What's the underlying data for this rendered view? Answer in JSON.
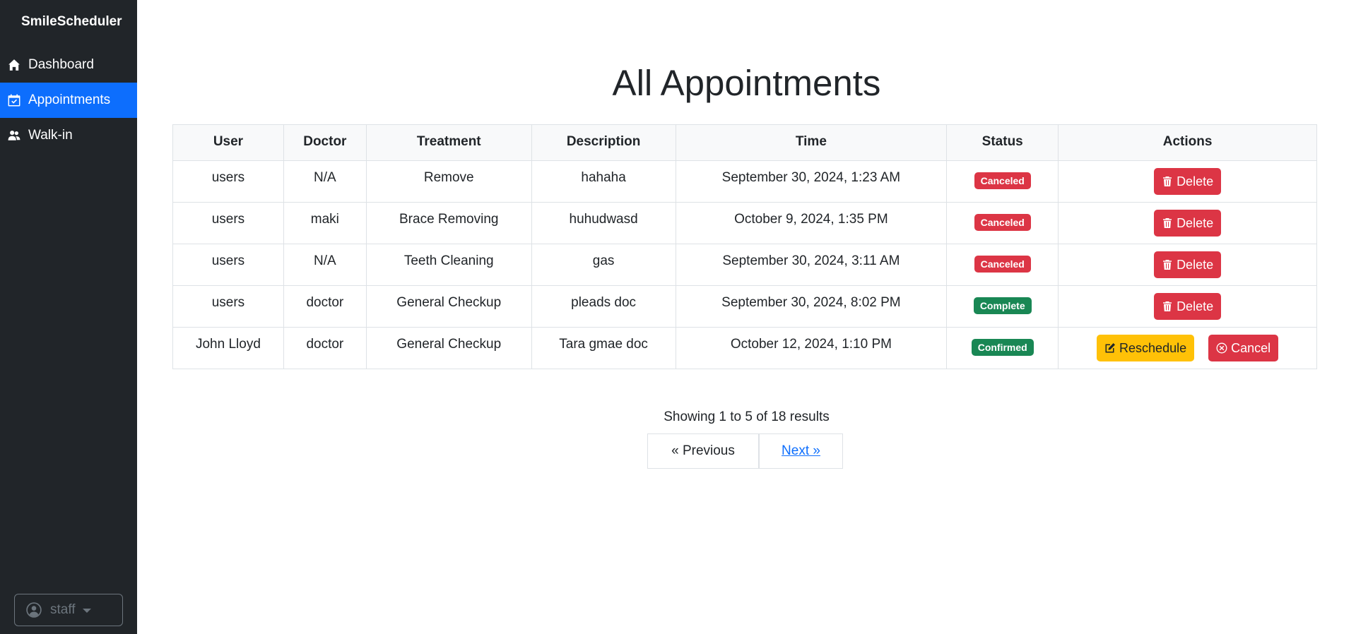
{
  "app": {
    "brand": "SmileScheduler"
  },
  "sidebar": {
    "items": [
      {
        "label": "Dashboard",
        "icon": "house-icon",
        "active": false
      },
      {
        "label": "Appointments",
        "icon": "calendar-check-icon",
        "active": true
      },
      {
        "label": "Walk-in",
        "icon": "people-icon",
        "active": false
      }
    ],
    "user": {
      "name": "staff",
      "icon": "person-circle-icon"
    }
  },
  "main": {
    "title": "All Appointments",
    "table": {
      "headers": [
        "User",
        "Doctor",
        "Treatment",
        "Description",
        "Time",
        "Status",
        "Actions"
      ],
      "rows": [
        {
          "user": "users",
          "doctor": "N/A",
          "treatment": "Remove",
          "description": "hahaha",
          "time": "September 30, 2024, 1:23 AM",
          "status": "Canceled",
          "actions": [
            "Delete"
          ]
        },
        {
          "user": "users",
          "doctor": "maki",
          "treatment": "Brace Removing",
          "description": "huhudwasd",
          "time": "October 9, 2024, 1:35 PM",
          "status": "Canceled",
          "actions": [
            "Delete"
          ]
        },
        {
          "user": "users",
          "doctor": "N/A",
          "treatment": "Teeth Cleaning",
          "description": "gas",
          "time": "September 30, 2024, 3:11 AM",
          "status": "Canceled",
          "actions": [
            "Delete"
          ]
        },
        {
          "user": "users",
          "doctor": "doctor",
          "treatment": "General Checkup",
          "description": "pleads doc",
          "time": "September 30, 2024, 8:02 PM",
          "status": "Complete",
          "actions": [
            "Delete"
          ]
        },
        {
          "user": "John Lloyd",
          "doctor": "doctor",
          "treatment": "General Checkup",
          "description": "Tara gmae doc",
          "time": "October 12, 2024, 1:10 PM",
          "status": "Confirmed",
          "actions": [
            "Reschedule",
            "Cancel"
          ]
        }
      ]
    },
    "pagination": {
      "info": "Showing 1 to 5 of 18 results",
      "previous": "« Previous",
      "next": "Next »"
    }
  },
  "colors": {
    "sidebar_bg": "#212529",
    "active_nav": "#0d6efd",
    "danger": "#dc3545",
    "success": "#198754",
    "warning": "#ffc107",
    "link": "#0d6efd"
  }
}
